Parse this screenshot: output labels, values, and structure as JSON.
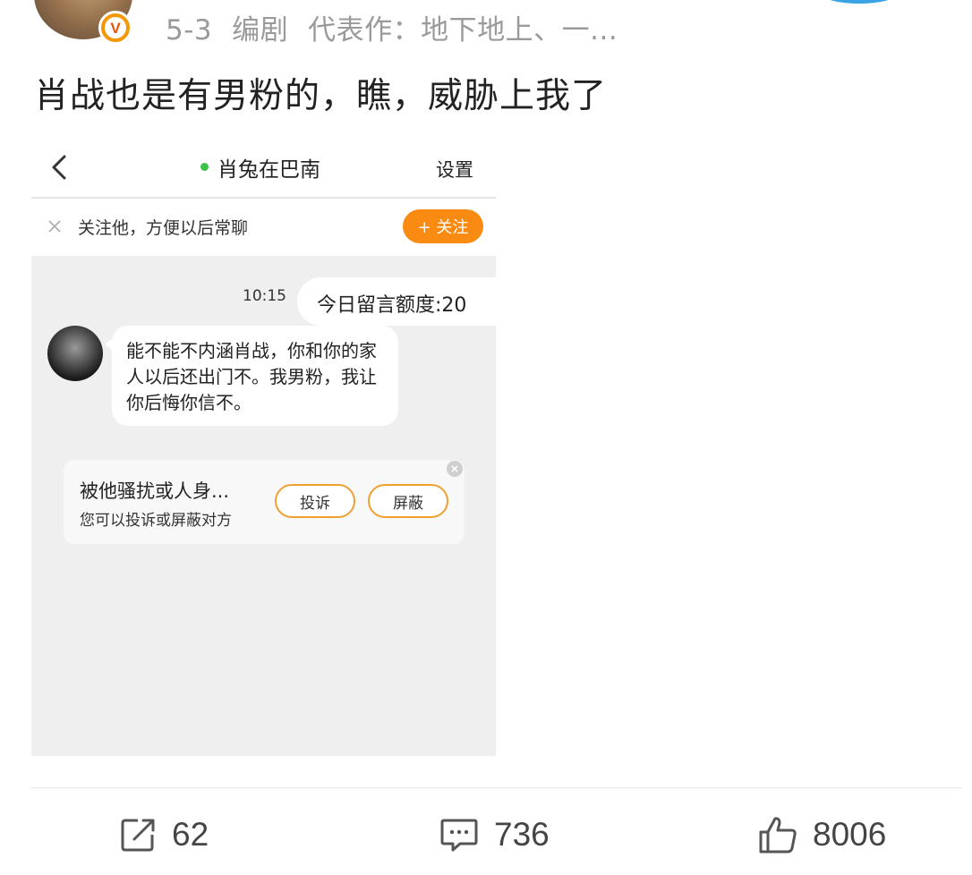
{
  "header": {
    "date": "5-3",
    "role": "编剧",
    "works": "代表作：地下地上、一..."
  },
  "post": {
    "text": "肖战也是有男粉的，瞧，威胁上我了"
  },
  "screenshot": {
    "nav": {
      "title": "肖兔在巴南",
      "settings_label": "设置"
    },
    "follow_bar": {
      "text": "关注他，方便以后常聊",
      "button_label": "+ 关注"
    },
    "chat": {
      "time": "10:15",
      "quota_text": "今日留言额度:20",
      "message": "能不能不内涵肖战，你和你的家人以后还出门不。我男粉，我让你后悔你信不。"
    },
    "report_card": {
      "title": "被他骚扰或人身...",
      "subtitle": "您可以投诉或屏蔽对方",
      "complain_label": "投诉",
      "block_label": "屏蔽"
    }
  },
  "actions": {
    "repost_count": "62",
    "comment_count": "736",
    "like_count": "8006"
  },
  "colors": {
    "accent_orange": "#f98b12",
    "verified_badge": "#f39800",
    "online_dot": "#3cc24a"
  },
  "icons": [
    "verified-badge-icon",
    "chevron-left-icon",
    "close-icon",
    "repost-icon",
    "comment-icon",
    "like-icon"
  ]
}
